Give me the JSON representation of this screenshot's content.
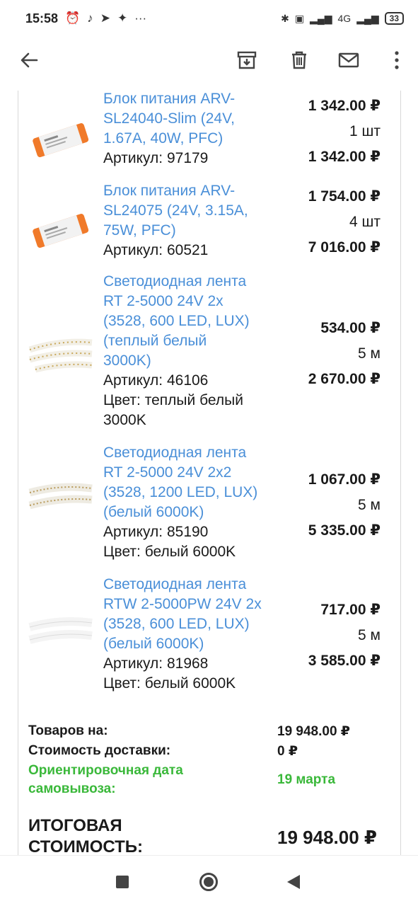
{
  "status": {
    "time": "15:58",
    "left_icons": [
      "alarm-icon",
      "tiktok-icon",
      "telegram-icon",
      "emblem-icon",
      "more-dots-icon"
    ],
    "network": "4G",
    "battery": "33"
  },
  "app_bar": {
    "icons": [
      "back-icon",
      "archive-icon",
      "delete-icon",
      "mail-icon",
      "more-icon"
    ]
  },
  "products": [
    {
      "name": "Блок питания ARV-SL24040-Slim (24V, 1.67A, 40W, PFC)",
      "name_lines": [
        "Блок питания ARV-",
        "SL24040-Slim (24V,",
        "1.67A, 40W, PFC)"
      ],
      "article": "Артикул: 97179",
      "color": "",
      "price": "1 342.00 ₽",
      "qty": "1 шт",
      "sum": "1 342.00 ₽",
      "thumb": "power-supply"
    },
    {
      "name": "Блок питания ARV-SL24075 (24V, 3.15A, 75W, PFC)",
      "name_lines": [
        "Блок питания ARV-",
        "SL24075 (24V, 3.15A,",
        "75W, PFC)"
      ],
      "article": "Артикул: 60521",
      "color": "",
      "price": "1 754.00 ₽",
      "qty": "4 шт",
      "sum": "7 016.00 ₽",
      "thumb": "power-supply"
    },
    {
      "name": "Светодиодная лента RT 2-5000 24V 2x (3528, 600 LED, LUX) (теплый белый 3000K)",
      "name_lines": [
        "Светодиодная лента",
        "RT 2-5000 24V 2x",
        "(3528, 600 LED, LUX)",
        "(теплый белый",
        "3000K)"
      ],
      "article": "Артикул: 46106",
      "color_lines": [
        "Цвет: теплый белый",
        "3000K"
      ],
      "price": "534.00 ₽",
      "qty": "5 м",
      "sum": "2 670.00 ₽",
      "thumb": "led-strip-warm"
    },
    {
      "name": "Светодиодная лента RT 2-5000 24V 2x2 (3528, 1200 LED, LUX) (белый 6000K)",
      "name_lines": [
        "Светодиодная лента",
        "RT 2-5000 24V 2x2",
        "(3528, 1200 LED, LUX)",
        "(белый 6000K)"
      ],
      "article": "Артикул: 85190",
      "color_lines": [
        "Цвет: белый 6000K"
      ],
      "price": "1 067.00 ₽",
      "qty": "5 м",
      "sum": "5 335.00 ₽",
      "thumb": "led-strip-dense"
    },
    {
      "name": "Светодиодная лента RTW 2-5000PW 24V 2x (3528, 600 LED, LUX) (белый 6000K)",
      "name_lines": [
        "Светодиодная лента",
        "RTW 2-5000PW 24V 2x",
        "(3528, 600 LED, LUX)",
        "(белый 6000K)"
      ],
      "article": "Артикул: 81968",
      "color_lines": [
        "Цвет: белый 6000K"
      ],
      "price": "717.00 ₽",
      "qty": "5 м",
      "sum": "3 585.00 ₽",
      "thumb": "led-strip-coated"
    }
  ],
  "summary": {
    "goods_label": "Товаров на:",
    "goods_value": "19 948.00 ₽",
    "delivery_label": "Стоимость доставки:",
    "delivery_value": "0 ₽",
    "pickup_label_lines": [
      "Ориентировочная дата",
      "самовывоза:"
    ],
    "pickup_value": "19 марта",
    "total_label_lines": [
      "ИТОГОВАЯ",
      "СТОИМОСТЬ:"
    ],
    "total_value": "19 948.00 ₽"
  },
  "colors": {
    "link": "#4a8fd8",
    "green": "#3ab83a",
    "text": "#1a1a1a"
  },
  "nav": [
    "recent-apps-button",
    "home-button",
    "back-button"
  ]
}
